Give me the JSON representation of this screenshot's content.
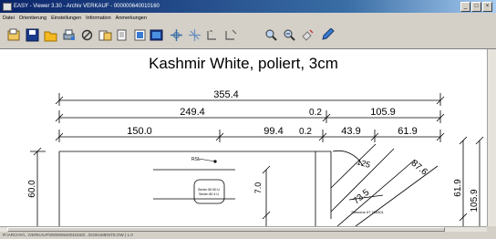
{
  "window": {
    "title": "EASY - Viewer 3.30 - Archiv VERKAUF - 000000640010160",
    "controls": {
      "minimize": "_",
      "maximize": "□",
      "close": "×"
    }
  },
  "menu": [
    "Datei",
    "Orientierung",
    "Einstellungen",
    "Information",
    "Anmerkungen"
  ],
  "toolbar": [
    "open-icon",
    "save-icon",
    "folder-icon",
    "print-icon",
    "rotate-icon",
    "copy-icon",
    "page-icon",
    "fit-page-icon",
    "image-icon",
    "crosshair-icon",
    "grid-icon",
    "measure-icon",
    "zoom-icon",
    "zoom-in-icon",
    "hand-icon",
    "help-icon"
  ],
  "drawing": {
    "title": "Kashmir White, poliert, 3cm",
    "dimensions": {
      "total": "355.4",
      "d249": "249.4",
      "d02a": "0.2",
      "d1059a": "105.9",
      "d150": "150.0",
      "d994": "99.4",
      "d02b": "0.2",
      "d439": "43.9",
      "d619a": "61.9",
      "d600": "60.0",
      "d70": "7.0",
      "d876": "87.6",
      "d735": "73.5",
      "d125": "125",
      "d619b": "61.9",
      "d1059b": "105.9"
    },
    "labels": {
      "hob_label": "RSL",
      "cutout_line1": "Serien 80 60 U",
      "cutout_line2": "Serien 80 4 U",
      "sink_label": "Siemens 07 785301"
    }
  },
  "status": "R:\\ARCHIV\\...\\VERKAUF\\000000640010160\\...\\DOKUMENTE.DW  |  1.0"
}
